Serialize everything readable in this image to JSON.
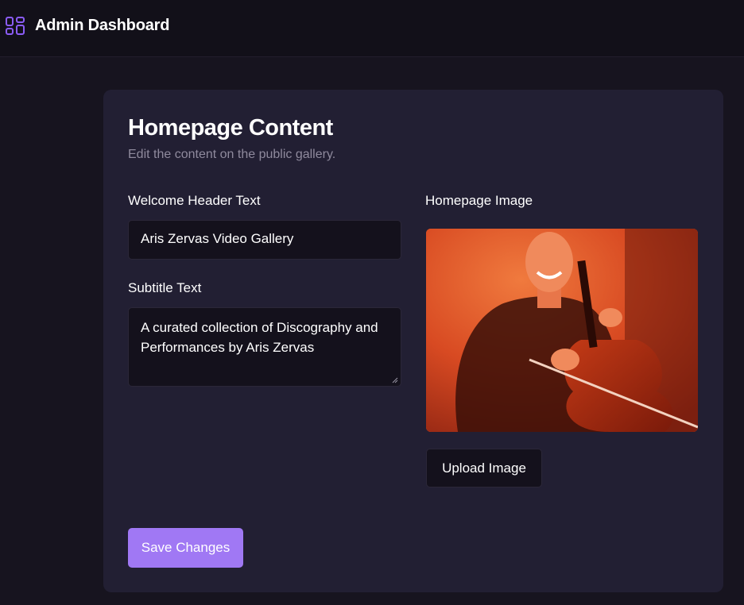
{
  "header": {
    "title": "Admin Dashboard",
    "icon": "dashboard-grid-icon",
    "accent_color": "#8b5cf6"
  },
  "card": {
    "title": "Homepage Content",
    "subtitle": "Edit the content on the public gallery."
  },
  "form": {
    "welcome_label": "Welcome Header Text",
    "welcome_value": "Aris Zervas Video Gallery",
    "subtitle_label": "Subtitle Text",
    "subtitle_value": "A curated collection of Discography and Performances by Aris Zervas",
    "image_label": "Homepage Image",
    "upload_label": "Upload Image",
    "save_label": "Save Changes",
    "save_color": "#a078f4"
  }
}
